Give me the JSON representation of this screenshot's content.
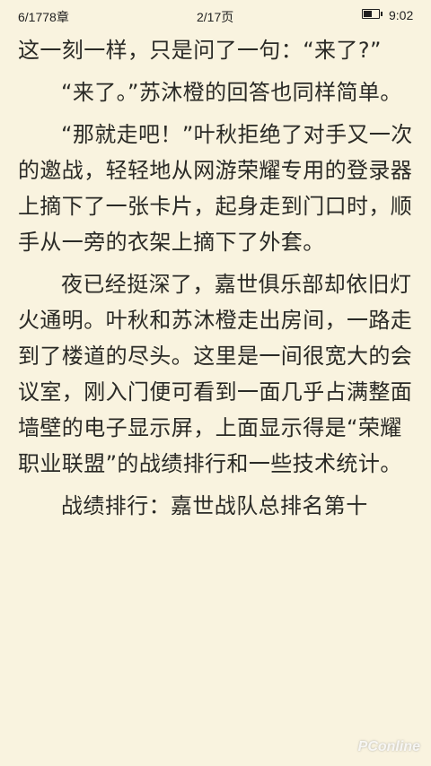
{
  "status_bar": {
    "chapter_progress": "6/1778章",
    "page_progress": "2/17页",
    "battery_icon": "battery-icon",
    "battery_level": 0.5,
    "time": "9:02"
  },
  "book_text": {
    "paragraphs": [
      "这一刻一样，只是问了一句：“来了?”",
      "“来了。”苏沐橙的回答也同样简单。",
      "“那就走吧！”叶秋拒绝了对手又一次的邀战，轻轻地从网游荣耀专用的登录器上摘下了一张卡片，起身走到门口时，顺手从一旁的衣架上摘下了外套。",
      "夜已经挺深了，嘉世俱乐部却依旧灯火通明。叶秋和苏沐橙走出房间，一路走到了楼道的尽头。这里是一间很宽大的会议室，刚入门便可看到一面几乎占满整面墙壁的电子显示屏，上面显示得是“荣耀职业联盟”的战绩排行和一些技术统计。",
      "战绩排行：嘉世战队总排名第十"
    ]
  },
  "watermark": {
    "text": "PConline"
  }
}
